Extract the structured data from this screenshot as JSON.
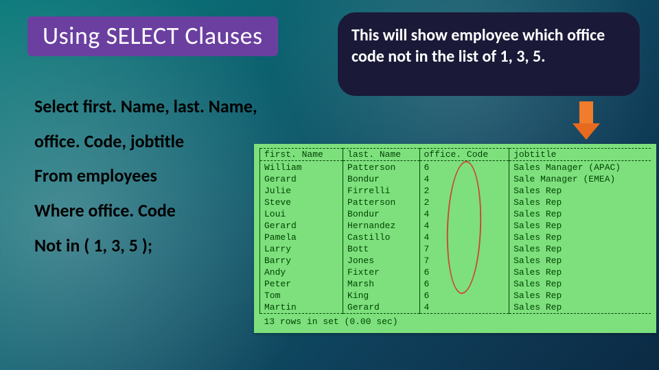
{
  "title": "Using SELECT Clauses",
  "callout": "This will show employee which office code not in the list of 1, 3, 5.",
  "query": {
    "l1": "Select first. Name, last. Name,",
    "l2": "office. Code, jobtitle",
    "l3": "From employees",
    "l4": "Where office. Code",
    "l5": "Not in ( 1, 3, 5 );"
  },
  "result_headers": [
    "first. Name",
    "last. Name",
    "office. Code",
    "jobtitle"
  ],
  "result_rows": [
    [
      "William",
      "Patterson",
      "6",
      "Sales Manager (APAC)"
    ],
    [
      "Gerard",
      "Bondur",
      "4",
      "Sale Manager (EMEA)"
    ],
    [
      "Julie",
      "Firrelli",
      "2",
      "Sales Rep"
    ],
    [
      "Steve",
      "Patterson",
      "2",
      "Sales Rep"
    ],
    [
      "Loui",
      "Bondur",
      "4",
      "Sales Rep"
    ],
    [
      "Gerard",
      "Hernandez",
      "4",
      "Sales Rep"
    ],
    [
      "Pamela",
      "Castillo",
      "4",
      "Sales Rep"
    ],
    [
      "Larry",
      "Bott",
      "7",
      "Sales Rep"
    ],
    [
      "Barry",
      "Jones",
      "7",
      "Sales Rep"
    ],
    [
      "Andy",
      "Fixter",
      "6",
      "Sales Rep"
    ],
    [
      "Peter",
      "Marsh",
      "6",
      "Sales Rep"
    ],
    [
      "Tom",
      "King",
      "6",
      "Sales Rep"
    ],
    [
      "Martin",
      "Gerard",
      "4",
      "Sales Rep"
    ]
  ],
  "result_footer": "13 rows in set (0.00 sec)"
}
